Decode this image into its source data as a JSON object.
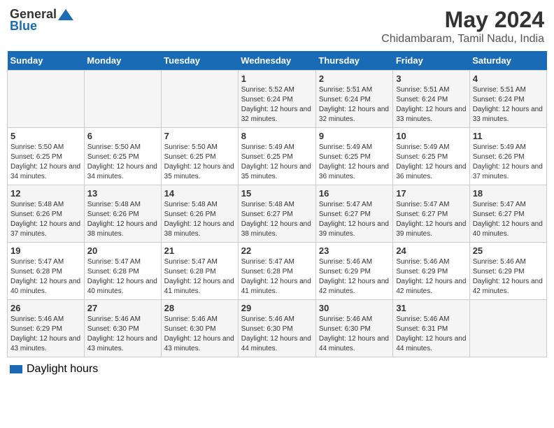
{
  "logo": {
    "general": "General",
    "blue": "Blue"
  },
  "title": "May 2024",
  "subtitle": "Chidambaram, Tamil Nadu, India",
  "days_of_week": [
    "Sunday",
    "Monday",
    "Tuesday",
    "Wednesday",
    "Thursday",
    "Friday",
    "Saturday"
  ],
  "weeks": [
    [
      {
        "day": "",
        "info": ""
      },
      {
        "day": "",
        "info": ""
      },
      {
        "day": "",
        "info": ""
      },
      {
        "day": "1",
        "info": "Sunrise: 5:52 AM\nSunset: 6:24 PM\nDaylight: 12 hours and 32 minutes."
      },
      {
        "day": "2",
        "info": "Sunrise: 5:51 AM\nSunset: 6:24 PM\nDaylight: 12 hours and 32 minutes."
      },
      {
        "day": "3",
        "info": "Sunrise: 5:51 AM\nSunset: 6:24 PM\nDaylight: 12 hours and 33 minutes."
      },
      {
        "day": "4",
        "info": "Sunrise: 5:51 AM\nSunset: 6:24 PM\nDaylight: 12 hours and 33 minutes."
      }
    ],
    [
      {
        "day": "5",
        "info": "Sunrise: 5:50 AM\nSunset: 6:25 PM\nDaylight: 12 hours and 34 minutes."
      },
      {
        "day": "6",
        "info": "Sunrise: 5:50 AM\nSunset: 6:25 PM\nDaylight: 12 hours and 34 minutes."
      },
      {
        "day": "7",
        "info": "Sunrise: 5:50 AM\nSunset: 6:25 PM\nDaylight: 12 hours and 35 minutes."
      },
      {
        "day": "8",
        "info": "Sunrise: 5:49 AM\nSunset: 6:25 PM\nDaylight: 12 hours and 35 minutes."
      },
      {
        "day": "9",
        "info": "Sunrise: 5:49 AM\nSunset: 6:25 PM\nDaylight: 12 hours and 36 minutes."
      },
      {
        "day": "10",
        "info": "Sunrise: 5:49 AM\nSunset: 6:25 PM\nDaylight: 12 hours and 36 minutes."
      },
      {
        "day": "11",
        "info": "Sunrise: 5:49 AM\nSunset: 6:26 PM\nDaylight: 12 hours and 37 minutes."
      }
    ],
    [
      {
        "day": "12",
        "info": "Sunrise: 5:48 AM\nSunset: 6:26 PM\nDaylight: 12 hours and 37 minutes."
      },
      {
        "day": "13",
        "info": "Sunrise: 5:48 AM\nSunset: 6:26 PM\nDaylight: 12 hours and 38 minutes."
      },
      {
        "day": "14",
        "info": "Sunrise: 5:48 AM\nSunset: 6:26 PM\nDaylight: 12 hours and 38 minutes."
      },
      {
        "day": "15",
        "info": "Sunrise: 5:48 AM\nSunset: 6:27 PM\nDaylight: 12 hours and 38 minutes."
      },
      {
        "day": "16",
        "info": "Sunrise: 5:47 AM\nSunset: 6:27 PM\nDaylight: 12 hours and 39 minutes."
      },
      {
        "day": "17",
        "info": "Sunrise: 5:47 AM\nSunset: 6:27 PM\nDaylight: 12 hours and 39 minutes."
      },
      {
        "day": "18",
        "info": "Sunrise: 5:47 AM\nSunset: 6:27 PM\nDaylight: 12 hours and 40 minutes."
      }
    ],
    [
      {
        "day": "19",
        "info": "Sunrise: 5:47 AM\nSunset: 6:28 PM\nDaylight: 12 hours and 40 minutes."
      },
      {
        "day": "20",
        "info": "Sunrise: 5:47 AM\nSunset: 6:28 PM\nDaylight: 12 hours and 40 minutes."
      },
      {
        "day": "21",
        "info": "Sunrise: 5:47 AM\nSunset: 6:28 PM\nDaylight: 12 hours and 41 minutes."
      },
      {
        "day": "22",
        "info": "Sunrise: 5:47 AM\nSunset: 6:28 PM\nDaylight: 12 hours and 41 minutes."
      },
      {
        "day": "23",
        "info": "Sunrise: 5:46 AM\nSunset: 6:29 PM\nDaylight: 12 hours and 42 minutes."
      },
      {
        "day": "24",
        "info": "Sunrise: 5:46 AM\nSunset: 6:29 PM\nDaylight: 12 hours and 42 minutes."
      },
      {
        "day": "25",
        "info": "Sunrise: 5:46 AM\nSunset: 6:29 PM\nDaylight: 12 hours and 42 minutes."
      }
    ],
    [
      {
        "day": "26",
        "info": "Sunrise: 5:46 AM\nSunset: 6:29 PM\nDaylight: 12 hours and 43 minutes."
      },
      {
        "day": "27",
        "info": "Sunrise: 5:46 AM\nSunset: 6:30 PM\nDaylight: 12 hours and 43 minutes."
      },
      {
        "day": "28",
        "info": "Sunrise: 5:46 AM\nSunset: 6:30 PM\nDaylight: 12 hours and 43 minutes."
      },
      {
        "day": "29",
        "info": "Sunrise: 5:46 AM\nSunset: 6:30 PM\nDaylight: 12 hours and 44 minutes."
      },
      {
        "day": "30",
        "info": "Sunrise: 5:46 AM\nSunset: 6:30 PM\nDaylight: 12 hours and 44 minutes."
      },
      {
        "day": "31",
        "info": "Sunrise: 5:46 AM\nSunset: 6:31 PM\nDaylight: 12 hours and 44 minutes."
      },
      {
        "day": "",
        "info": ""
      }
    ]
  ],
  "legend": {
    "daylight_label": "Daylight hours"
  }
}
